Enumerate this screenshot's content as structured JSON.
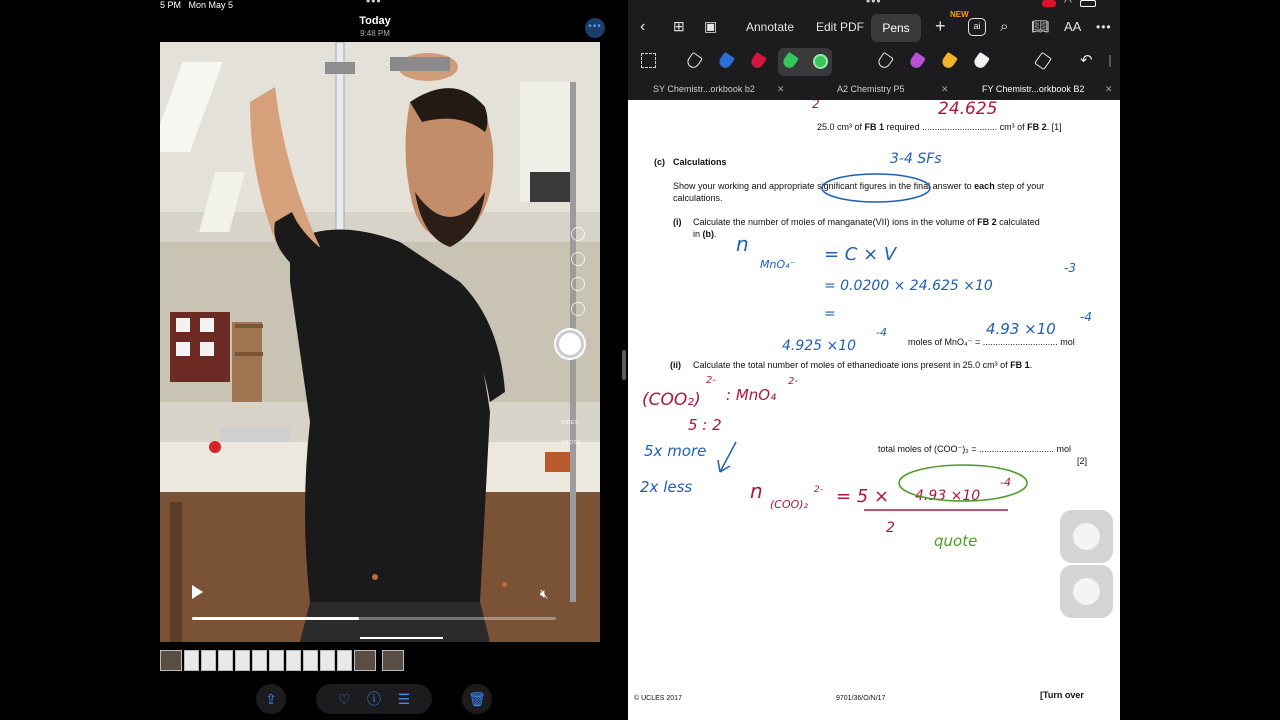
{
  "photos_app": {
    "status_time": "5 PM",
    "status_date": "Mon May 5",
    "title": "Today",
    "time": "9:48 PM",
    "camera_labels": {
      "video": "VIDEO",
      "photo": "PHOTO"
    },
    "playback_progress": 0.46,
    "toolbar": {
      "share_icon": "share-icon",
      "favorite_icon": "heart-icon",
      "info_icon": "info-icon",
      "adjust_icon": "sliders-icon",
      "delete_icon": "trash-icon"
    }
  },
  "pdf_app": {
    "toolbar": {
      "annotate": "Annotate",
      "edit_pdf": "Edit PDF",
      "pens": "Pens",
      "new_badge": "NEW",
      "ai_label": "ai",
      "text_size": "AA"
    },
    "doc_tabs": [
      {
        "label": "SY Chemistr...orkbook b2"
      },
      {
        "label": "A2 Chemistry P5"
      },
      {
        "label": "FY Chemistr...orkbook B2"
      }
    ],
    "colors": {
      "pen_active": "#34c759",
      "blue_ink": "#1f5fb8",
      "red_ink": "#b0163b",
      "green_ink": "#4e9a26"
    },
    "page": {
      "line_top": "25.0 cm³ of FB 1 required .............................. cm³ of FB 2.  [1]",
      "line_top_a": "25.0 cm³ of ",
      "line_top_b": "FB 1",
      "line_top_c": " required .............................. cm³ of ",
      "line_top_d": "FB 2",
      "line_top_e": ".  [1]",
      "c_label": "(c)",
      "c_title": "Calculations",
      "c_instr_1a": "Show your working and appropriate significant figures in the final answer to ",
      "c_instr_1b": "each",
      "c_instr_1c": " step of your",
      "c_instr_2": "calculations.",
      "i_label": "(i)",
      "i_text_1a": "Calculate the number of moles of manganate(VII) ions in the volume of ",
      "i_text_1b": "FB 2",
      "i_text_1c": " calculated",
      "i_text_2a": "in ",
      "i_text_2b": "(b)",
      "i_text_2c": ".",
      "i_answer": "moles of MnO₄⁻ = .............................. mol",
      "ii_label": "(ii)",
      "ii_text_a": "Calculate the total number of moles of ethanedioate ions present in 25.0 cm³ of ",
      "ii_text_b": "FB 1",
      "ii_text_c": ".",
      "ii_answer": "total moles of (COO⁻)₂ = .............................. mol",
      "ii_marks": "[2]",
      "footer_left": "© UCLES 2017",
      "footer_mid": "9701/36/O/N/17",
      "footer_right": "[Turn over"
    },
    "handwriting": {
      "top_value": "24.625",
      "sig_figs": "3-4 SFs",
      "eq1_lhs": "n",
      "eq1_sub": "MnO₄⁻",
      "eq1_rhs": "= C × V",
      "eq2": "= 0.0200 × 24.625 ×10",
      "eq2_exp": "-3",
      "eq3": "=",
      "result_left": "4.925 ×10",
      "result_left_exp": "-4",
      "result_answer": "4.93 ×10",
      "result_answer_exp": "-4",
      "ratio_lhs": "(COO₂)",
      "ratio_lhs_exp": "2-",
      "ratio_colon": ": MnO₄",
      "ratio_rhs_exp": "2-",
      "ratio_nums": "5  :  2",
      "note_more": "5x more",
      "note_less": "2x less",
      "eq4_lhs": "n",
      "eq4_sub": "(COO)₂",
      "eq4_sub_exp": "2-",
      "eq4_rhs": "= 5 ×",
      "eq4_circled": "4.93 ×10",
      "eq4_circled_exp": "-4",
      "eq4_den": "2",
      "quote": "quote"
    }
  }
}
